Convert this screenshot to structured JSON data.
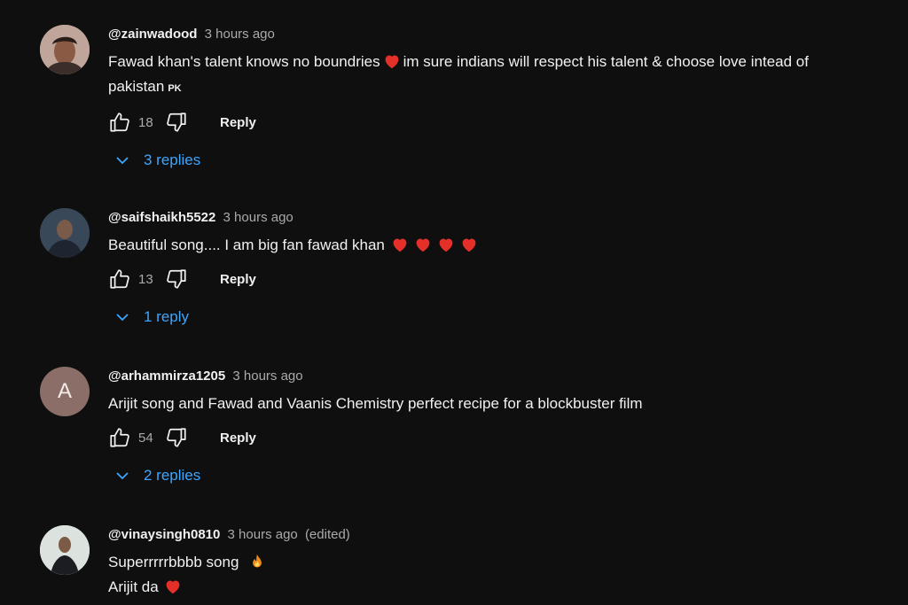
{
  "comments": [
    {
      "handle": "@zainwadood",
      "time": "3 hours ago",
      "lines": [
        "Fawad khan's talent knows no boundries",
        "im sure indians will respect his talent & choose love intead of",
        "pakistan",
        "PK"
      ],
      "likes": "18",
      "reply_label": "Reply",
      "replies_label": "3 replies"
    },
    {
      "handle": "@saifshaikh5522",
      "time": "3 hours ago",
      "lines": [
        "Beautiful song.... I am big fan fawad khan"
      ],
      "likes": "13",
      "reply_label": "Reply",
      "replies_label": "1 reply"
    },
    {
      "handle": "@arhammirza1205",
      "time": "3 hours ago",
      "avatar_letter": "A",
      "lines": [
        "Arijit song and Fawad and Vaanis Chemistry perfect recipe for a blockbuster film"
      ],
      "likes": "54",
      "reply_label": "Reply",
      "replies_label": "2 replies"
    },
    {
      "handle": "@vinaysingh0810",
      "time": "3 hours ago",
      "edited": "(edited)",
      "lines": [
        "Superrrrrbbbb song",
        "Arijit da"
      ]
    }
  ],
  "colors": {
    "background": "#0f0f0f",
    "link_blue": "#3ea6ff",
    "heart_red": "#e5302a"
  },
  "icons": [
    "thumbs-up-icon",
    "thumbs-down-icon",
    "chevron-down-icon",
    "heart-icon",
    "fire-icon"
  ]
}
